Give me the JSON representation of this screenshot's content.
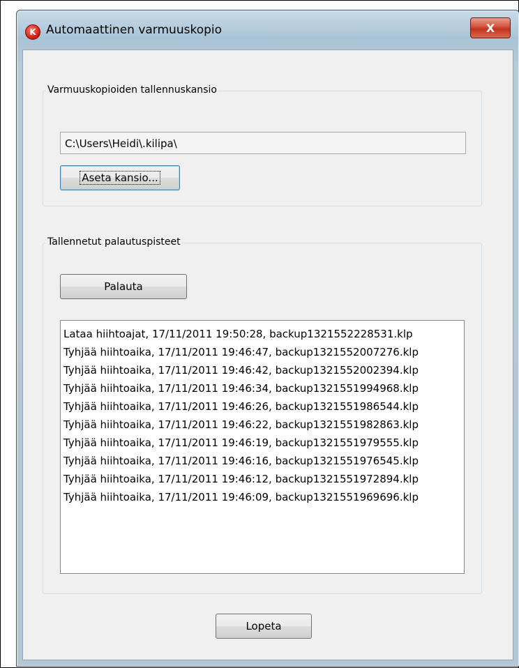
{
  "window": {
    "title": "Automaattinen varmuuskopio",
    "close_label": "X",
    "app_icon_glyph": "K",
    "app_icon_name": "app-logo-icon"
  },
  "backup_folder": {
    "group_label": "Varmuuskopioiden tallennuskansio",
    "path_value": "C:\\Users\\Heidi\\.kilipa\\",
    "set_folder_button": "Aseta kansio..."
  },
  "restore_points": {
    "group_label": "Tallennetut palautuspisteet",
    "restore_button": "Palauta",
    "items": [
      "Lataa hiihtoajat, 17/11/2011 19:50:28, backup1321552228531.klp",
      "Tyhjää hiihtoaika, 17/11/2011 19:46:47, backup1321552007276.klp",
      "Tyhjää hiihtoaika, 17/11/2011 19:46:42, backup1321552002394.klp",
      "Tyhjää hiihtoaika, 17/11/2011 19:46:34, backup1321551994968.klp",
      "Tyhjää hiihtoaika, 17/11/2011 19:46:26, backup1321551986544.klp",
      "Tyhjää hiihtoaika, 17/11/2011 19:46:22, backup1321551982863.klp",
      "Tyhjää hiihtoaika, 17/11/2011 19:46:19, backup1321551979555.klp",
      "Tyhjää hiihtoaika, 17/11/2011 19:46:16, backup1321551976545.klp",
      "Tyhjää hiihtoaika, 17/11/2011 19:46:12, backup1321551972894.klp",
      "Tyhjää hiihtoaika, 17/11/2011 19:46:09, backup1321551969696.klp"
    ]
  },
  "footer": {
    "quit_button": "Lopeta"
  },
  "colors": {
    "close_button": "#c7422a",
    "app_icon": "#d21b12"
  }
}
